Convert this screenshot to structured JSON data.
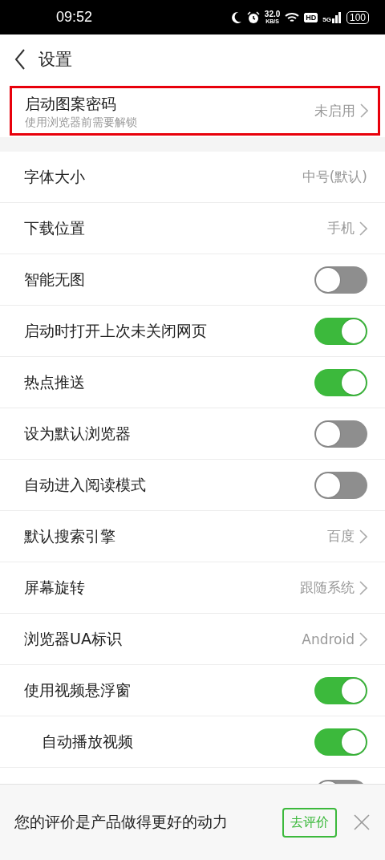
{
  "status_bar": {
    "time": "09:52",
    "speed": "32.0",
    "speed_unit": "KB/S",
    "hd": "HD",
    "network": "5G",
    "battery": "100"
  },
  "header": {
    "title": "设置"
  },
  "pattern_lock": {
    "title": "启动图案密码",
    "subtitle": "使用浏览器前需要解锁",
    "value": "未启用"
  },
  "settings": [
    {
      "kind": "value",
      "label": "字体大小",
      "value": "中号(默认)",
      "chevron": false
    },
    {
      "kind": "value",
      "label": "下载位置",
      "value": "手机",
      "chevron": true
    },
    {
      "kind": "toggle",
      "label": "智能无图",
      "on": false
    },
    {
      "kind": "toggle",
      "label": "启动时打开上次未关闭网页",
      "on": true
    },
    {
      "kind": "toggle",
      "label": "热点推送",
      "on": true
    },
    {
      "kind": "toggle",
      "label": "设为默认浏览器",
      "on": false
    },
    {
      "kind": "toggle",
      "label": "自动进入阅读模式",
      "on": false
    },
    {
      "kind": "value",
      "label": "默认搜索引擎",
      "value": "百度",
      "chevron": true
    },
    {
      "kind": "value",
      "label": "屏幕旋转",
      "value": "跟随系统",
      "chevron": true
    },
    {
      "kind": "value",
      "label": "浏览器UA标识",
      "value": "Android",
      "chevron": true
    },
    {
      "kind": "toggle",
      "label": "使用视频悬浮窗",
      "on": true,
      "children": [
        {
          "kind": "toggle",
          "label": "自动播放视频",
          "on": true
        }
      ]
    },
    {
      "kind": "toggle",
      "on": false
    }
  ],
  "rating_banner": {
    "text": "您的评价是产品做得更好的动力",
    "button": "去评价"
  }
}
